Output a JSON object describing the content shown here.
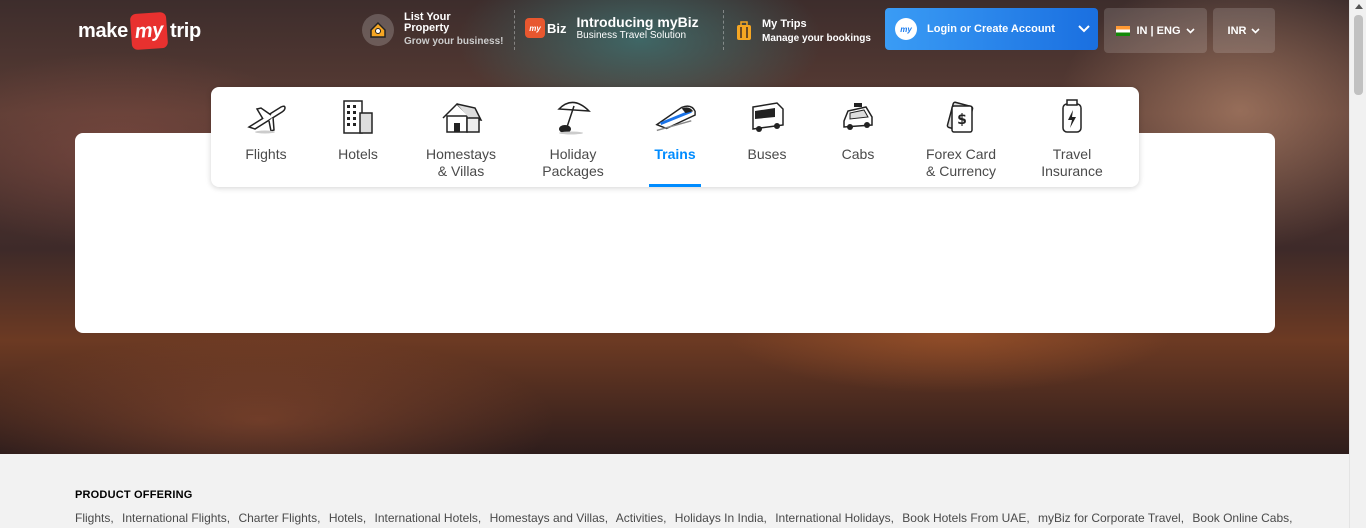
{
  "brand": {
    "make": "make",
    "my": "my",
    "trip": "trip"
  },
  "header": {
    "list_property": {
      "title": "List Your Property",
      "subtitle": "Grow your business!"
    },
    "mybiz": {
      "badge": "Biz",
      "badge_prefix": "my",
      "title": "Introducing myBiz",
      "subtitle": "Business Travel Solution"
    },
    "my_trips": {
      "title": "My Trips",
      "subtitle": "Manage your bookings"
    },
    "login": {
      "avatar": "my",
      "label": "Login or Create Account"
    },
    "language": {
      "label": "IN | ENG"
    },
    "currency": {
      "label": "INR"
    }
  },
  "nav": {
    "items": [
      {
        "id": "flights",
        "label": "Flights",
        "icon": "airplane-icon"
      },
      {
        "id": "hotels",
        "label": "Hotels",
        "icon": "hotel-building-icon"
      },
      {
        "id": "homestays",
        "label": "Homestays\n& Villas",
        "icon": "house-icon"
      },
      {
        "id": "holidays",
        "label": "Holiday\nPackages",
        "icon": "beach-umbrella-icon"
      },
      {
        "id": "trains",
        "label": "Trains",
        "icon": "train-icon",
        "active": true
      },
      {
        "id": "buses",
        "label": "Buses",
        "icon": "bus-icon"
      },
      {
        "id": "cabs",
        "label": "Cabs",
        "icon": "car-icon"
      },
      {
        "id": "forex",
        "label": "Forex Card\n& Currency",
        "icon": "currency-card-icon"
      },
      {
        "id": "insurance",
        "label": "Travel\nInsurance",
        "icon": "insurance-shield-icon"
      }
    ]
  },
  "footer": {
    "heading": "PRODUCT OFFERING",
    "links": [
      "Flights,",
      "International Flights,",
      "Charter Flights,",
      "Hotels,",
      "International Hotels,",
      "Homestays and Villas,",
      "Activities,",
      "Holidays In India,",
      "International Holidays,",
      "Book Hotels From UAE,",
      "myBiz for Corporate Travel,",
      "Book Online Cabs,"
    ]
  },
  "colors": {
    "accent": "#008cff",
    "brand_red": "#e8312f",
    "login_gradient_start": "#3a9cf5",
    "login_gradient_end": "#1a6fe0"
  }
}
